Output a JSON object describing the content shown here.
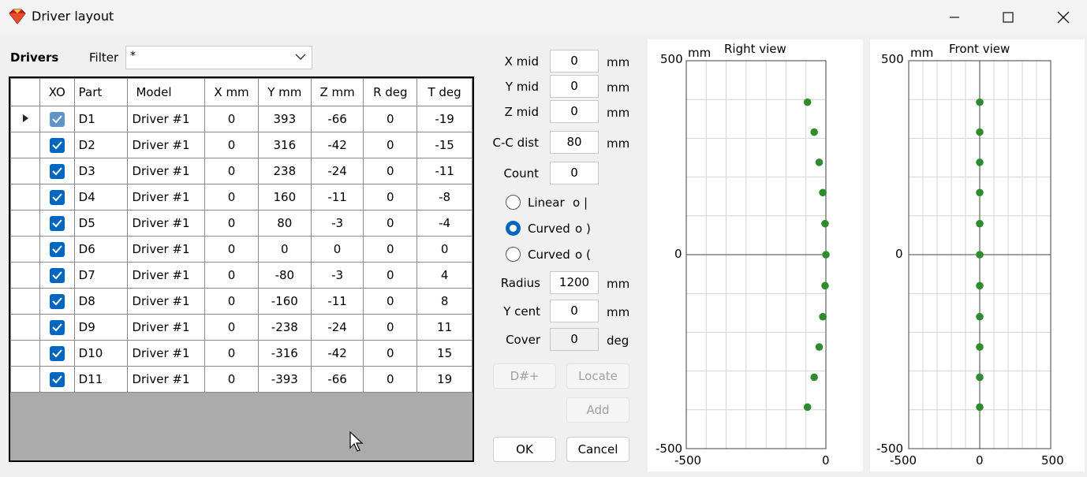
{
  "window": {
    "title": "Driver layout"
  },
  "left": {
    "drivers_label": "Drivers",
    "filter_label": "Filter",
    "filter_value": "*"
  },
  "table": {
    "headers": [
      "XO",
      "Part",
      "Model",
      "X mm",
      "Y mm",
      "Z mm",
      "R deg",
      "T deg"
    ],
    "rows": [
      {
        "xo": true,
        "part": "D1",
        "model": "Driver #1",
        "x": "0",
        "y": "393",
        "z": "-66",
        "r": "0",
        "t": "-19"
      },
      {
        "xo": true,
        "part": "D2",
        "model": "Driver #1",
        "x": "0",
        "y": "316",
        "z": "-42",
        "r": "0",
        "t": "-15"
      },
      {
        "xo": true,
        "part": "D3",
        "model": "Driver #1",
        "x": "0",
        "y": "238",
        "z": "-24",
        "r": "0",
        "t": "-11"
      },
      {
        "xo": true,
        "part": "D4",
        "model": "Driver #1",
        "x": "0",
        "y": "160",
        "z": "-11",
        "r": "0",
        "t": "-8"
      },
      {
        "xo": true,
        "part": "D5",
        "model": "Driver #1",
        "x": "0",
        "y": "80",
        "z": "-3",
        "r": "0",
        "t": "-4"
      },
      {
        "xo": true,
        "part": "D6",
        "model": "Driver #1",
        "x": "0",
        "y": "0",
        "z": "0",
        "r": "0",
        "t": "0"
      },
      {
        "xo": true,
        "part": "D7",
        "model": "Driver #1",
        "x": "0",
        "y": "-80",
        "z": "-3",
        "r": "0",
        "t": "4"
      },
      {
        "xo": true,
        "part": "D8",
        "model": "Driver #1",
        "x": "0",
        "y": "-160",
        "z": "-11",
        "r": "0",
        "t": "8"
      },
      {
        "xo": true,
        "part": "D9",
        "model": "Driver #1",
        "x": "0",
        "y": "-238",
        "z": "-24",
        "r": "0",
        "t": "11"
      },
      {
        "xo": true,
        "part": "D10",
        "model": "Driver #1",
        "x": "0",
        "y": "-316",
        "z": "-42",
        "r": "0",
        "t": "15"
      },
      {
        "xo": true,
        "part": "D11",
        "model": "Driver #1",
        "x": "0",
        "y": "-393",
        "z": "-66",
        "r": "0",
        "t": "19"
      }
    ]
  },
  "params": {
    "x_mid": {
      "label": "X mid",
      "value": "0",
      "unit": "mm"
    },
    "y_mid": {
      "label": "Y mid",
      "value": "0",
      "unit": "mm"
    },
    "z_mid": {
      "label": "Z mid",
      "value": "0",
      "unit": "mm"
    },
    "cc_dist": {
      "label": "C-C dist",
      "value": "80",
      "unit": "mm"
    },
    "count": {
      "label": "Count",
      "value": "0"
    },
    "radio_linear": {
      "label": "Linear",
      "symbol": "o |",
      "selected": false
    },
    "radio_curved1": {
      "label": "Curved",
      "symbol": "o )",
      "selected": true
    },
    "radio_curved2": {
      "label": "Curved",
      "symbol": "o (",
      "selected": false
    },
    "radius": {
      "label": "Radius",
      "value": "1200",
      "unit": "mm"
    },
    "y_cent": {
      "label": "Y cent",
      "value": "0",
      "unit": "mm"
    },
    "cover": {
      "label": "Cover",
      "value": "0",
      "unit": "deg"
    }
  },
  "buttons": {
    "d_plus": "D#+",
    "locate": "Locate",
    "add": "Add",
    "ok": "OK",
    "cancel": "Cancel"
  },
  "views": {
    "point_color": "#2e8b2e",
    "right": {
      "title": "Right view",
      "unit": "mm",
      "y_ticks": [
        "500",
        "0",
        "-500"
      ],
      "x_ticks": [
        "-500",
        "0"
      ],
      "xlim": [
        -500,
        0
      ],
      "ylim": [
        -500,
        500
      ],
      "points": [
        [
          -66,
          393
        ],
        [
          -42,
          316
        ],
        [
          -24,
          238
        ],
        [
          -11,
          160
        ],
        [
          -3,
          80
        ],
        [
          0,
          0
        ],
        [
          -3,
          -80
        ],
        [
          -11,
          -160
        ],
        [
          -24,
          -238
        ],
        [
          -42,
          -316
        ],
        [
          -66,
          -393
        ]
      ]
    },
    "front": {
      "title": "Front view",
      "unit": "mm",
      "y_ticks": [
        "500",
        "0",
        "-500"
      ],
      "x_ticks": [
        "-500",
        "0",
        "500"
      ],
      "xlim": [
        -500,
        500
      ],
      "ylim": [
        -500,
        500
      ],
      "points": [
        [
          0,
          393
        ],
        [
          0,
          316
        ],
        [
          0,
          238
        ],
        [
          0,
          160
        ],
        [
          0,
          80
        ],
        [
          0,
          0
        ],
        [
          0,
          -80
        ],
        [
          0,
          -160
        ],
        [
          0,
          -238
        ],
        [
          0,
          -316
        ],
        [
          0,
          -393
        ]
      ]
    }
  }
}
